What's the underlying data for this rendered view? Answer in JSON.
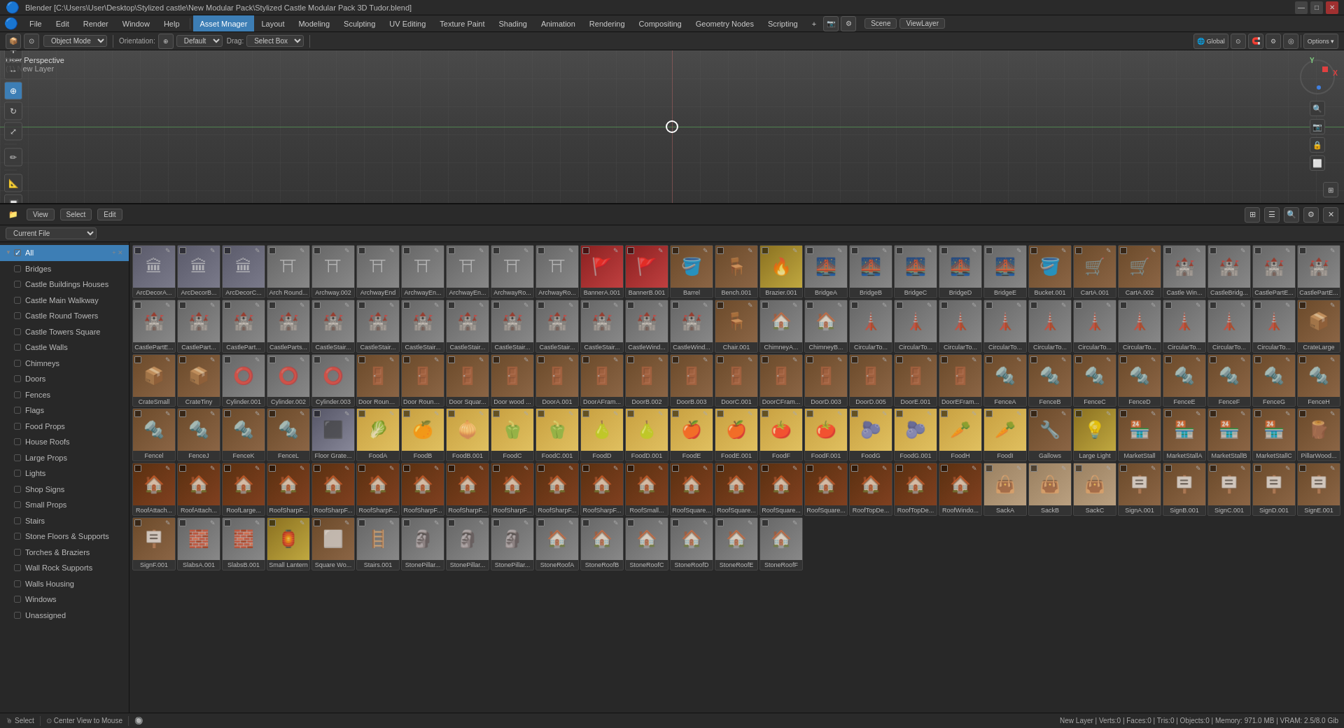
{
  "titleBar": {
    "title": "Blender [C:\\Users\\User\\Desktop\\Stylized castle\\New Modular Pack\\Stylized Castle Modular Pack 3D Tudor.blend]",
    "controls": [
      "—",
      "□",
      "✕"
    ]
  },
  "menuBar": {
    "items": [
      "Blender",
      "File",
      "Edit",
      "Render",
      "Window",
      "Help"
    ],
    "tabs": [
      "Asset Mnager",
      "Layout",
      "Modeling",
      "Sculpting",
      "UV Editing",
      "Texture Paint",
      "Shading",
      "Animation",
      "Rendering",
      "Compositing",
      "Geometry Nodes",
      "Scripting",
      "+"
    ],
    "activeTab": "Asset Mnager",
    "rightItems": [
      "Scene",
      "ViewLayer"
    ]
  },
  "toolbar": {
    "objectMode": "Object Mode",
    "orientationLabel": "Orientation:",
    "orientation": "Default",
    "dragLabel": "Drag:",
    "drag": "Select Box",
    "globalLabel": "Global",
    "pivotBtn": "⊙",
    "optionsBtn": "Options ▾"
  },
  "viewport": {
    "perspLabel": "User Perspective",
    "layerLabel": "(1) New Layer"
  },
  "assetBrowser": {
    "headerBtns": [
      "View",
      "Select",
      "Edit"
    ],
    "sourceLabel": "Current File",
    "categoryAll": "All",
    "categories": [
      "Bridges",
      "Castle Buildings Houses",
      "Castle Main Walkway",
      "Castle Round Towers",
      "Castle Towers Square",
      "Castle Walls",
      "Chimneys",
      "Doors",
      "Fences",
      "Flags",
      "Food Props",
      "House Roofs",
      "Large Props",
      "Lights",
      "Shop Signs",
      "Small Props",
      "Stairs",
      "Stone Floors & Supports",
      "Torches & Braziers",
      "Wall Rock Supports",
      "Walls Housing",
      "Windows",
      "Unassigned"
    ]
  },
  "assets": [
    {
      "label": "ArcDecorA...",
      "thumb": "arch",
      "icon": "🏛"
    },
    {
      "label": "ArcDecorB...",
      "thumb": "arch",
      "icon": "🏛"
    },
    {
      "label": "ArcDecorC...",
      "thumb": "arch",
      "icon": "🏛"
    },
    {
      "label": "Arch Round...",
      "thumb": "stone",
      "icon": "⛩"
    },
    {
      "label": "Archway.002",
      "thumb": "stone",
      "icon": "⛩"
    },
    {
      "label": "ArchwayEnd",
      "thumb": "stone",
      "icon": "⛩"
    },
    {
      "label": "ArchwayEn...",
      "thumb": "stone",
      "icon": "⛩"
    },
    {
      "label": "ArchwayEn...",
      "thumb": "stone",
      "icon": "⛩"
    },
    {
      "label": "ArchwayRo...",
      "thumb": "stone",
      "icon": "⛩"
    },
    {
      "label": "ArchwayRo...",
      "thumb": "stone",
      "icon": "⛩"
    },
    {
      "label": "BannerA.001",
      "thumb": "red",
      "icon": "🚩"
    },
    {
      "label": "BannerB.001",
      "thumb": "red",
      "icon": "🚩"
    },
    {
      "label": "Barrel",
      "thumb": "wood",
      "icon": "🪣"
    },
    {
      "label": "Bench.001",
      "thumb": "wood",
      "icon": "🪑"
    },
    {
      "label": "Brazier.001",
      "thumb": "gold",
      "icon": "🔥"
    },
    {
      "label": "BridgeA",
      "thumb": "stone",
      "icon": "🌉"
    },
    {
      "label": "BridgeB",
      "thumb": "stone",
      "icon": "🌉"
    },
    {
      "label": "BridgeC",
      "thumb": "stone",
      "icon": "🌉"
    },
    {
      "label": "BridgeD",
      "thumb": "stone",
      "icon": "🌉"
    },
    {
      "label": "BridgeE",
      "thumb": "stone",
      "icon": "🌉"
    },
    {
      "label": "Bucket.001",
      "thumb": "wood",
      "icon": "🪣"
    },
    {
      "label": "CartA.001",
      "thumb": "wood",
      "icon": "🛒"
    },
    {
      "label": "CartA.002",
      "thumb": "wood",
      "icon": "🛒"
    },
    {
      "label": "Castle Win...",
      "thumb": "stone",
      "icon": "🏰"
    },
    {
      "label": "CastleBridg...",
      "thumb": "stone",
      "icon": "🏰"
    },
    {
      "label": "CastlePartE...",
      "thumb": "stone",
      "icon": "🏰"
    },
    {
      "label": "CastlePartE...",
      "thumb": "stone",
      "icon": "🏰"
    },
    {
      "label": "CastlePartE...",
      "thumb": "stone",
      "icon": "🏰"
    },
    {
      "label": "CastlePart...",
      "thumb": "stone",
      "icon": "🏰"
    },
    {
      "label": "CastlePart...",
      "thumb": "stone",
      "icon": "🏰"
    },
    {
      "label": "CastleParts...",
      "thumb": "stone",
      "icon": "🏰"
    },
    {
      "label": "CastleStair...",
      "thumb": "stone",
      "icon": "🏰"
    },
    {
      "label": "CastleStair...",
      "thumb": "stone",
      "icon": "🏰"
    },
    {
      "label": "CastleStair...",
      "thumb": "stone",
      "icon": "🏰"
    },
    {
      "label": "CastleStair...",
      "thumb": "stone",
      "icon": "🏰"
    },
    {
      "label": "CastleStair...",
      "thumb": "stone",
      "icon": "🏰"
    },
    {
      "label": "CastleStair...",
      "thumb": "stone",
      "icon": "🏰"
    },
    {
      "label": "CastleStair...",
      "thumb": "stone",
      "icon": "🏰"
    },
    {
      "label": "CastleWind...",
      "thumb": "stone",
      "icon": "🏰"
    },
    {
      "label": "CastleWind...",
      "thumb": "stone",
      "icon": "🏰"
    },
    {
      "label": "Chair.001",
      "thumb": "wood",
      "icon": "🪑"
    },
    {
      "label": "ChimneyA...",
      "thumb": "stone",
      "icon": "🏠"
    },
    {
      "label": "ChimneyB...",
      "thumb": "stone",
      "icon": "🏠"
    },
    {
      "label": "CircularTo...",
      "thumb": "stone",
      "icon": "🗼"
    },
    {
      "label": "CircularTo...",
      "thumb": "stone",
      "icon": "🗼"
    },
    {
      "label": "CircularTo...",
      "thumb": "stone",
      "icon": "🗼"
    },
    {
      "label": "CircularTo...",
      "thumb": "stone",
      "icon": "🗼"
    },
    {
      "label": "CircularTo...",
      "thumb": "stone",
      "icon": "🗼"
    },
    {
      "label": "CircularTo...",
      "thumb": "stone",
      "icon": "🗼"
    },
    {
      "label": "CircularTo...",
      "thumb": "stone",
      "icon": "🗼"
    },
    {
      "label": "CircularTo...",
      "thumb": "stone",
      "icon": "🗼"
    },
    {
      "label": "CircularTo...",
      "thumb": "stone",
      "icon": "🗼"
    },
    {
      "label": "CircularTo...",
      "thumb": "stone",
      "icon": "🗼"
    },
    {
      "label": "CrateLarge",
      "thumb": "wood",
      "icon": "📦"
    },
    {
      "label": "CrateSmall",
      "thumb": "wood",
      "icon": "📦"
    },
    {
      "label": "CrateTiny",
      "thumb": "wood",
      "icon": "📦"
    },
    {
      "label": "Cylinder.001",
      "thumb": "stone",
      "icon": "⭕"
    },
    {
      "label": "Cylinder.002",
      "thumb": "stone",
      "icon": "⭕"
    },
    {
      "label": "Cylinder.003",
      "thumb": "stone",
      "icon": "⭕"
    },
    {
      "label": "Door Round...",
      "thumb": "wood",
      "icon": "🚪"
    },
    {
      "label": "Door Round...",
      "thumb": "wood",
      "icon": "🚪"
    },
    {
      "label": "Door Squar...",
      "thumb": "wood",
      "icon": "🚪"
    },
    {
      "label": "Door wood ...",
      "thumb": "wood",
      "icon": "🚪"
    },
    {
      "label": "DoorA.001",
      "thumb": "wood",
      "icon": "🚪"
    },
    {
      "label": "DoorAFram...",
      "thumb": "wood",
      "icon": "🚪"
    },
    {
      "label": "DoorB.002",
      "thumb": "wood",
      "icon": "🚪"
    },
    {
      "label": "DoorB.003",
      "thumb": "wood",
      "icon": "🚪"
    },
    {
      "label": "DoorC.001",
      "thumb": "wood",
      "icon": "🚪"
    },
    {
      "label": "DoorCFram...",
      "thumb": "wood",
      "icon": "🚪"
    },
    {
      "label": "DoorD.003",
      "thumb": "wood",
      "icon": "🚪"
    },
    {
      "label": "DoorD.005",
      "thumb": "wood",
      "icon": "🚪"
    },
    {
      "label": "DoorE.001",
      "thumb": "wood",
      "icon": "🚪"
    },
    {
      "label": "DoorEFram...",
      "thumb": "wood",
      "icon": "🚪"
    },
    {
      "label": "FenceA",
      "thumb": "wood",
      "icon": "🔩"
    },
    {
      "label": "FenceB",
      "thumb": "wood",
      "icon": "🔩"
    },
    {
      "label": "FenceC",
      "thumb": "wood",
      "icon": "🔩"
    },
    {
      "label": "FenceD",
      "thumb": "wood",
      "icon": "🔩"
    },
    {
      "label": "FenceE",
      "thumb": "wood",
      "icon": "🔩"
    },
    {
      "label": "FenceF",
      "thumb": "wood",
      "icon": "🔩"
    },
    {
      "label": "FenceG",
      "thumb": "wood",
      "icon": "🔩"
    },
    {
      "label": "FenceH",
      "thumb": "wood",
      "icon": "🔩"
    },
    {
      "label": "Fencel",
      "thumb": "wood",
      "icon": "🔩"
    },
    {
      "label": "FenceJ",
      "thumb": "wood",
      "icon": "🔩"
    },
    {
      "label": "FenceK",
      "thumb": "wood",
      "icon": "🔩"
    },
    {
      "label": "FenceL",
      "thumb": "wood",
      "icon": "🔩"
    },
    {
      "label": "Floor Grate...",
      "thumb": "metal",
      "icon": "⬛"
    },
    {
      "label": "FoodA",
      "thumb": "food",
      "icon": "🥬"
    },
    {
      "label": "FoodB",
      "thumb": "food",
      "icon": "🍊"
    },
    {
      "label": "FoodB.001",
      "thumb": "food",
      "icon": "🧅"
    },
    {
      "label": "FoodC",
      "thumb": "food",
      "icon": "🫑"
    },
    {
      "label": "FoodC.001",
      "thumb": "food",
      "icon": "🫑"
    },
    {
      "label": "FoodD",
      "thumb": "food",
      "icon": "🍐"
    },
    {
      "label": "FoodD.001",
      "thumb": "food",
      "icon": "🍐"
    },
    {
      "label": "FoodE",
      "thumb": "food",
      "icon": "🍎"
    },
    {
      "label": "FoodE.001",
      "thumb": "food",
      "icon": "🍎"
    },
    {
      "label": "FoodF",
      "thumb": "food",
      "icon": "🍅"
    },
    {
      "label": "FoodF.001",
      "thumb": "food",
      "icon": "🍅"
    },
    {
      "label": "FoodG",
      "thumb": "food",
      "icon": "🫐"
    },
    {
      "label": "FoodG.001",
      "thumb": "food",
      "icon": "🫐"
    },
    {
      "label": "FoodH",
      "thumb": "food",
      "icon": "🥕"
    },
    {
      "label": "FoodI",
      "thumb": "food",
      "icon": "🥕"
    },
    {
      "label": "Gallows",
      "thumb": "wood",
      "icon": "🔧"
    },
    {
      "label": "Large Light",
      "thumb": "gold",
      "icon": "💡"
    },
    {
      "label": "MarketStall",
      "thumb": "wood",
      "icon": "🏪"
    },
    {
      "label": "MarketStallA",
      "thumb": "wood",
      "icon": "🏪"
    },
    {
      "label": "MarketStallB",
      "thumb": "wood",
      "icon": "🏪"
    },
    {
      "label": "MarketStallC",
      "thumb": "wood",
      "icon": "🏪"
    },
    {
      "label": "PillarWood...",
      "thumb": "wood",
      "icon": "🪵"
    },
    {
      "label": "RoofAttach...",
      "thumb": "roof",
      "icon": "🏠"
    },
    {
      "label": "RoofAttach...",
      "thumb": "roof",
      "icon": "🏠"
    },
    {
      "label": "RoofLarge...",
      "thumb": "roof",
      "icon": "🏠"
    },
    {
      "label": "RoofSharpF...",
      "thumb": "roof",
      "icon": "🏠"
    },
    {
      "label": "RoofSharpF...",
      "thumb": "roof",
      "icon": "🏠"
    },
    {
      "label": "RoofSharpF...",
      "thumb": "roof",
      "icon": "🏠"
    },
    {
      "label": "RoofSharpF...",
      "thumb": "roof",
      "icon": "🏠"
    },
    {
      "label": "RoofSharpF...",
      "thumb": "roof",
      "icon": "🏠"
    },
    {
      "label": "RoofSharpF...",
      "thumb": "roof",
      "icon": "🏠"
    },
    {
      "label": "RoofSharpF...",
      "thumb": "roof",
      "icon": "🏠"
    },
    {
      "label": "RoofSharpF...",
      "thumb": "roof",
      "icon": "🏠"
    },
    {
      "label": "RoofSmall...",
      "thumb": "roof",
      "icon": "🏠"
    },
    {
      "label": "RoofSquare...",
      "thumb": "roof",
      "icon": "🏠"
    },
    {
      "label": "RoofSquare...",
      "thumb": "roof",
      "icon": "🏠"
    },
    {
      "label": "RoofSquare...",
      "thumb": "roof",
      "icon": "🏠"
    },
    {
      "label": "RoofSquare...",
      "thumb": "roof",
      "icon": "🏠"
    },
    {
      "label": "RoofTopDe...",
      "thumb": "roof",
      "icon": "🏠"
    },
    {
      "label": "RoofTopDe...",
      "thumb": "roof",
      "icon": "🏠"
    },
    {
      "label": "RoofWindo...",
      "thumb": "roof",
      "icon": "🏠"
    },
    {
      "label": "SackA",
      "thumb": "tan",
      "icon": "👜"
    },
    {
      "label": "SackB",
      "thumb": "tan",
      "icon": "👜"
    },
    {
      "label": "SackC",
      "thumb": "tan",
      "icon": "👜"
    },
    {
      "label": "SignA.001",
      "thumb": "wood",
      "icon": "🪧"
    },
    {
      "label": "SignB.001",
      "thumb": "wood",
      "icon": "🪧"
    },
    {
      "label": "SignC.001",
      "thumb": "wood",
      "icon": "🪧"
    },
    {
      "label": "SignD.001",
      "thumb": "wood",
      "icon": "🪧"
    },
    {
      "label": "SignE.001",
      "thumb": "wood",
      "icon": "🪧"
    },
    {
      "label": "SignF.001",
      "thumb": "wood",
      "icon": "🪧"
    },
    {
      "label": "SlabsA.001",
      "thumb": "stone",
      "icon": "🧱"
    },
    {
      "label": "SlabsB.001",
      "thumb": "stone",
      "icon": "🧱"
    },
    {
      "label": "Small Lantern",
      "thumb": "gold",
      "icon": "🏮"
    },
    {
      "label": "Square Wo...",
      "thumb": "wood",
      "icon": "⬜"
    },
    {
      "label": "Stairs.001",
      "thumb": "stone",
      "icon": "🪜"
    },
    {
      "label": "StonePillar...",
      "thumb": "stone",
      "icon": "🗿"
    },
    {
      "label": "StonePillar...",
      "thumb": "stone",
      "icon": "🗿"
    },
    {
      "label": "StonePillar...",
      "thumb": "stone",
      "icon": "🗿"
    },
    {
      "label": "StoneRoofA",
      "thumb": "stone",
      "icon": "🏠"
    },
    {
      "label": "StoneRoofB",
      "thumb": "stone",
      "icon": "🏠"
    },
    {
      "label": "StoneRoofC",
      "thumb": "stone",
      "icon": "🏠"
    },
    {
      "label": "StoneRoofD",
      "thumb": "stone",
      "icon": "🏠"
    },
    {
      "label": "StoneRoofE",
      "thumb": "stone",
      "icon": "🏠"
    },
    {
      "label": "StoneRoofF",
      "thumb": "stone",
      "icon": "🏠"
    }
  ],
  "statusBar": {
    "selectLabel": "Select",
    "centerLabel": "Center View to Mouse",
    "rightInfo": "New Layer | Verts:0 | Faces:0 | Tris:0 | Objects:0 | Memory: 971.0 MB | VRAM: 2.5/8.0 Gib"
  }
}
